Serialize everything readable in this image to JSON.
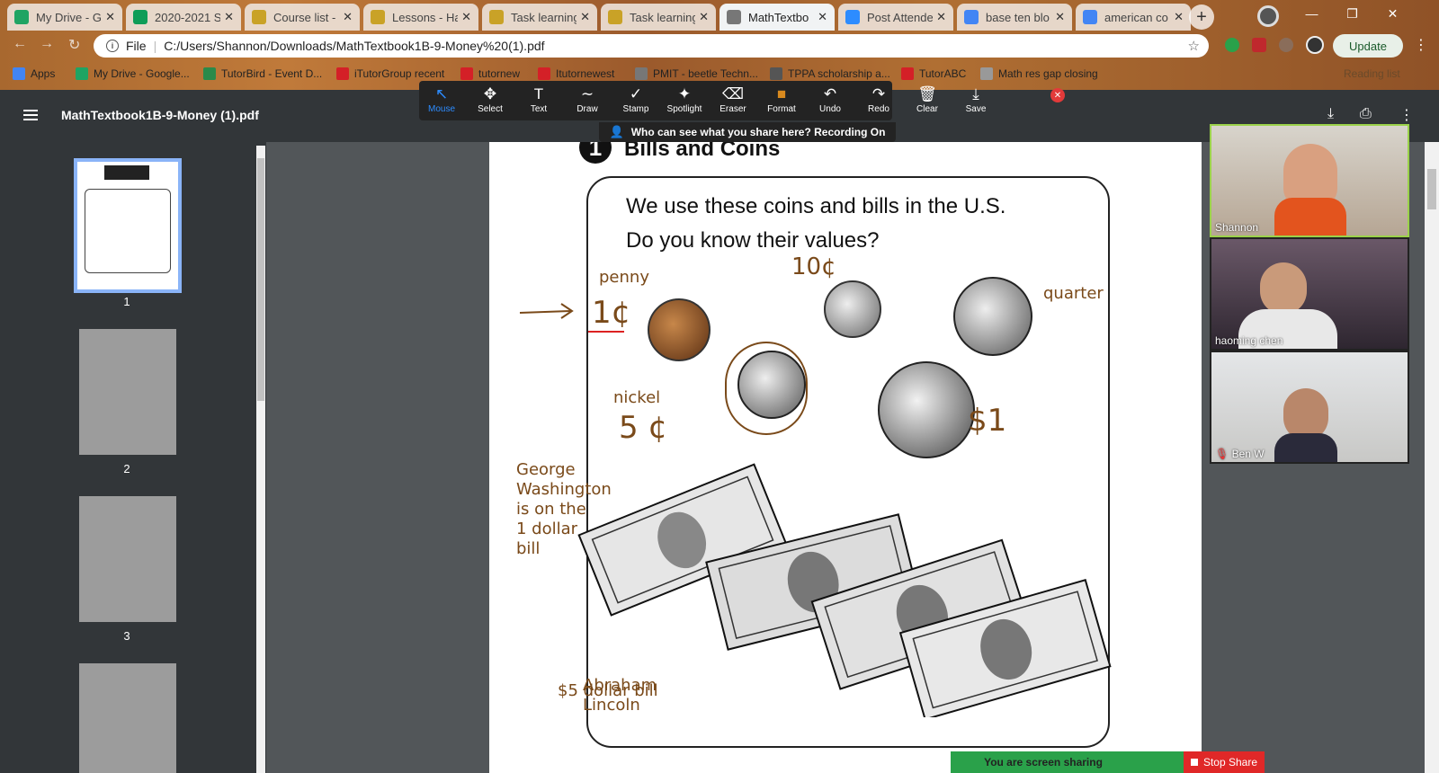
{
  "tabs": [
    {
      "label": "My Drive - G",
      "icon": "google-drive-icon",
      "color": "#1fa463"
    },
    {
      "label": "2020-2021 S",
      "icon": "sheets-icon",
      "color": "#0f9d58"
    },
    {
      "label": "Course list -",
      "icon": "page-icon",
      "color": "#c9a227"
    },
    {
      "label": "Lessons - Ha",
      "icon": "page-icon",
      "color": "#c9a227"
    },
    {
      "label": "Task learning",
      "icon": "page-icon",
      "color": "#c9a227"
    },
    {
      "label": "Task learning",
      "icon": "page-icon",
      "color": "#c9a227"
    },
    {
      "label": "MathTextbo",
      "icon": "globe-icon",
      "color": "#777777"
    },
    {
      "label": "Post Attende",
      "icon": "zoom-icon",
      "color": "#2d8cff"
    },
    {
      "label": "base ten blo",
      "icon": "google-icon",
      "color": "#4285f4"
    },
    {
      "label": "american co",
      "icon": "google-icon",
      "color": "#4285f4"
    }
  ],
  "address": {
    "scheme": "File",
    "url": "C:/Users/Shannon/Downloads/MathTextbook1B-9-Money%20(1).pdf"
  },
  "update_label": "Update",
  "reading_list": "Reading list",
  "bookmarks": [
    {
      "label": "Apps",
      "color": "#4285f4"
    },
    {
      "label": "My Drive - Google...",
      "color": "#1fa463"
    },
    {
      "label": "TutorBird - Event D...",
      "color": "#2a8a4a"
    },
    {
      "label": "iTutorGroup recent",
      "color": "#d42027"
    },
    {
      "label": "tutornew",
      "color": "#d42027"
    },
    {
      "label": "Itutornewest",
      "color": "#d42027"
    },
    {
      "label": "PMIT - beetle Techn...",
      "color": "#777777"
    },
    {
      "label": "TPPA scholarship a...",
      "color": "#555555"
    },
    {
      "label": "TutorABC",
      "color": "#d42027"
    },
    {
      "label": "Math res gap closing",
      "color": "#999999"
    }
  ],
  "pdf": {
    "title": "MathTextbook1B-9-Money (1).pdf",
    "pages": [
      "1",
      "2",
      "3"
    ]
  },
  "annotate": {
    "tools": [
      "Mouse",
      "Select",
      "Text",
      "Draw",
      "Stamp",
      "Spotlight",
      "Eraser",
      "Format",
      "Undo",
      "Redo",
      "Clear",
      "Save"
    ],
    "recording_notice": "Who can see what you share here? Recording On"
  },
  "textbook": {
    "section_number": "1",
    "heading": "Bills and Coins",
    "line1": "We use these coins and bills in the U.S.",
    "line2": "Do you know their values?"
  },
  "annotations": {
    "penny": "penny",
    "penny_value": "1¢",
    "dime_value": "10¢",
    "quarter": "quarter",
    "nickel": "nickel",
    "nickel_value": "5 ¢",
    "dollar_coin": "$1",
    "george": [
      "George",
      "Washington",
      "is on the",
      "1 dollar",
      "bill"
    ],
    "abraham": [
      "Abraham",
      "Lincoln"
    ],
    "five_bill": "$5 dollar bill"
  },
  "participants": [
    {
      "name": "Shannon"
    },
    {
      "name": "haoming  chen"
    },
    {
      "name": "Ben W"
    }
  ],
  "share": {
    "status": "You are screen sharing",
    "stop": "Stop Share"
  }
}
